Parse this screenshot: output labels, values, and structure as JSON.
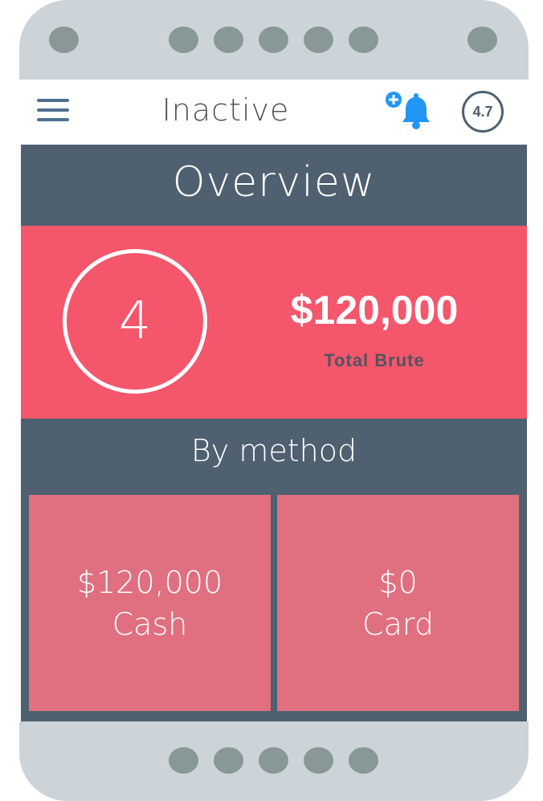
{
  "header": {
    "status": "Inactive",
    "rating": "4.7",
    "menu_icon": "hamburger-menu-icon",
    "notification_icon": "bell-plus-icon"
  },
  "overview": {
    "title": "Overview",
    "count": "4",
    "total_amount": "$120,000",
    "total_label": "Total Brute"
  },
  "by_method": {
    "title": "By method",
    "methods": [
      {
        "amount": "$120,000",
        "label": "Cash"
      },
      {
        "amount": "$0",
        "label": "Card"
      }
    ]
  },
  "colors": {
    "accent_red": "#f4566b",
    "card_pink": "#e07080",
    "slate": "#4f6070",
    "bell_blue": "#2196f3",
    "bezel": "#ccd4da"
  }
}
